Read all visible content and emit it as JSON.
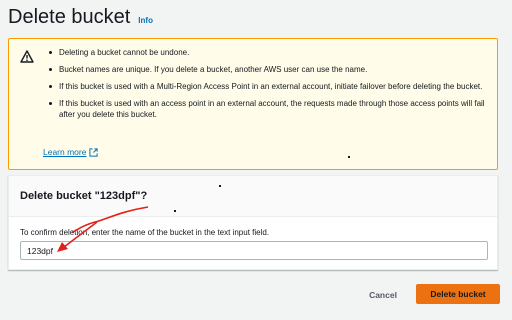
{
  "header": {
    "title": "Delete bucket",
    "info_link": "Info"
  },
  "warning": {
    "icon": "warning-triangle-icon",
    "items": [
      "Deleting a bucket cannot be undone.",
      "Bucket names are unique. If you delete a bucket, another AWS user can use the name.",
      "If this bucket is used with a Multi-Region Access Point in an external account, initiate failover before deleting the bucket.",
      "If this bucket is used with an access point in an external account, the requests made through those access points will fail after you delete this bucket."
    ],
    "learn_more": "Learn more",
    "learn_more_icon": "external-link-icon"
  },
  "confirm": {
    "title": "Delete bucket \"123dpf\"?",
    "label": "To confirm deletion, enter the name of the bucket in the text input field.",
    "input_value": "123dpf"
  },
  "footer": {
    "cancel_label": "Cancel",
    "delete_label": "Delete bucket"
  },
  "colors": {
    "accent": "#ec7211",
    "link": "#0073bb",
    "warning_bg": "#fffce9",
    "warning_border": "#ff9900",
    "annotation_arrow": "#e0201b"
  }
}
